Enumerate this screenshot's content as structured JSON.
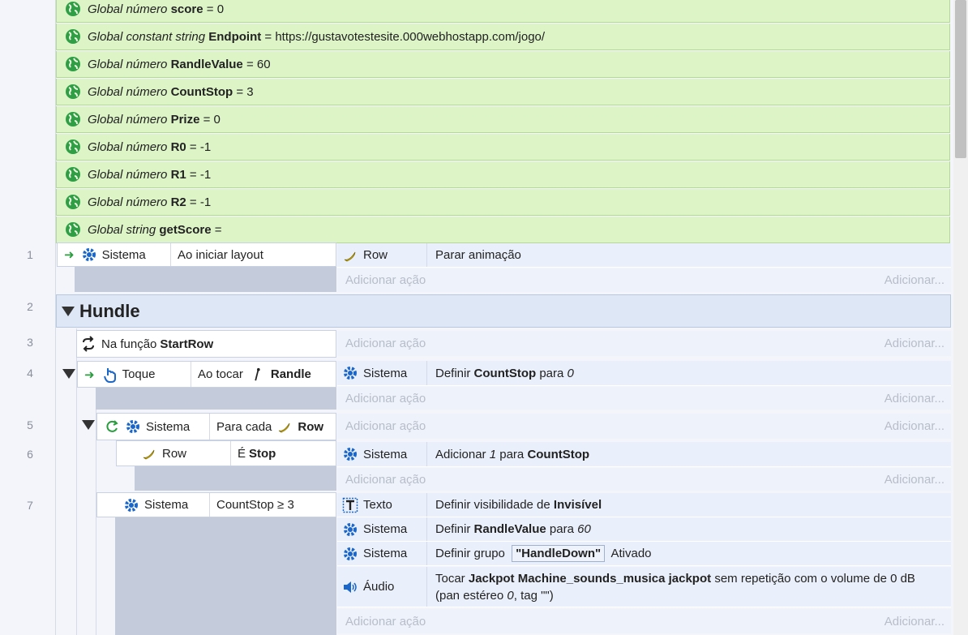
{
  "globals": [
    {
      "kind": "Global número",
      "name": "score",
      "value": "= 0"
    },
    {
      "kind": "Global constant string",
      "name": "Endpoint",
      "value": "= https://gustavotestesite.000webhostapp.com/jogo/"
    },
    {
      "kind": "Global número",
      "name": "RandleValue",
      "value": "= 60"
    },
    {
      "kind": "Global número",
      "name": "CountStop",
      "value": "= 3"
    },
    {
      "kind": "Global número",
      "name": "Prize",
      "value": "= 0"
    },
    {
      "kind": "Global número",
      "name": "R0",
      "value": "= -1"
    },
    {
      "kind": "Global número",
      "name": "R1",
      "value": "= -1"
    },
    {
      "kind": "Global número",
      "name": "R2",
      "value": "= -1"
    },
    {
      "kind": "Global string",
      "name": "getScore",
      "value": "="
    }
  ],
  "line_numbers": [
    "1",
    "2",
    "3",
    "4",
    "5",
    "6",
    "7"
  ],
  "common": {
    "add_action": "Adicionar ação",
    "add_more": "Adicionar..."
  },
  "event1": {
    "cond_obj": "Sistema",
    "cond_txt": "Ao iniciar layout",
    "act_obj": "Row",
    "act_txt": "Parar animação"
  },
  "group": {
    "title": "Hundle"
  },
  "event3": {
    "prefix": "Na função",
    "name": "StartRow"
  },
  "event4": {
    "cond_obj": "Toque",
    "cond_pre": "Ao tocar",
    "cond_target": "Randle",
    "act_obj": "Sistema",
    "act_pre": "Definir",
    "act_var": "CountStop",
    "act_mid": "para",
    "act_val": "0"
  },
  "event5": {
    "cond_obj": "Sistema",
    "cond_pre": "Para cada",
    "cond_target": "Row"
  },
  "event6": {
    "cond_obj": "Row",
    "cond_pre": "É",
    "cond_val": "Stop",
    "act_obj": "Sistema",
    "act_pre": "Adicionar",
    "act_val": "1",
    "act_mid": "para",
    "act_var": "CountStop"
  },
  "event7": {
    "cond_obj": "Sistema",
    "cond_txt": "CountStop ≥ 3",
    "a1_obj": "Texto",
    "a1_pre": "Definir visibilidade de",
    "a1_val": "Invisível",
    "a2_obj": "Sistema",
    "a2_pre": "Definir",
    "a2_var": "RandleValue",
    "a2_mid": "para",
    "a2_val": "60",
    "a3_obj": "Sistema",
    "a3_pre": "Definir grupo",
    "a3_chip": "\"HandleDown\"",
    "a3_post": "Ativado",
    "a4_obj": "Áudio",
    "a4_pre": "Tocar",
    "a4_sound": "Jackpot Machine_sounds_musica jackpot",
    "a4_mid": "sem repetição com o volume de 0 dB",
    "a4_line2_pre": "(pan estéreo",
    "a4_pan": "0",
    "a4_line2_post": ", tag \"\")"
  }
}
